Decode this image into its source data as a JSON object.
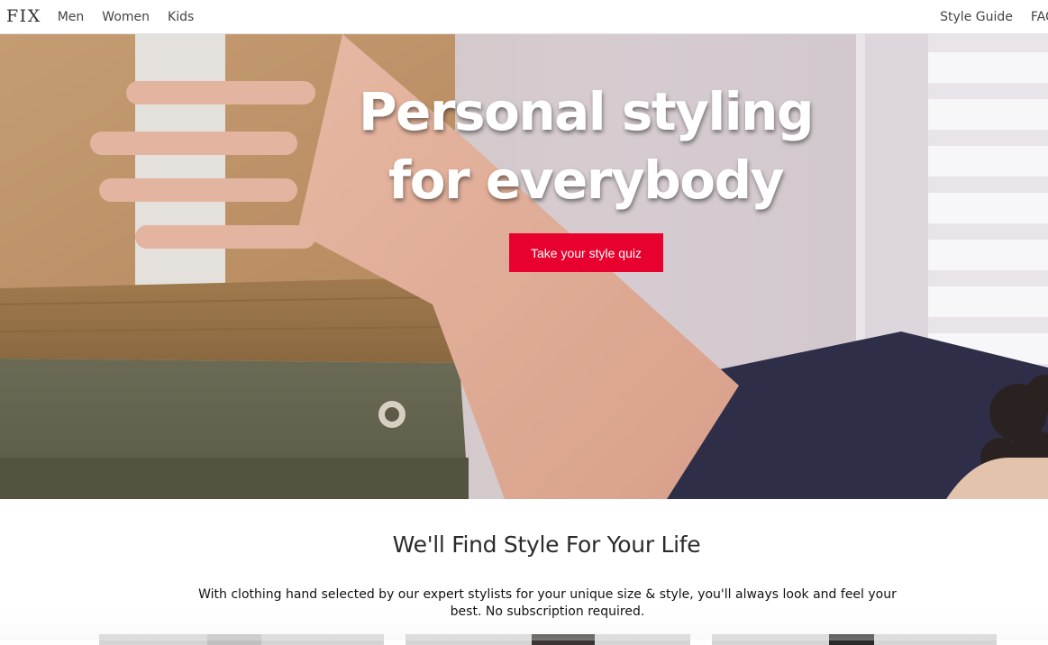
{
  "nav": {
    "logo": "FIX",
    "left_links": [
      "Men",
      "Women",
      "Kids"
    ],
    "right_links": [
      "Style Guide",
      "FAQ"
    ]
  },
  "hero": {
    "title": "Personal styling for everybody",
    "cta_label": "Take your style quiz"
  },
  "content": {
    "title": "We'll Find Style For Your Life",
    "text": "With clothing hand selected by our expert stylists for your unique size & style, you'll always look and feel your best. No subscription required."
  },
  "colors": {
    "cta": "#e8012e",
    "text": "#2b2b2b"
  }
}
